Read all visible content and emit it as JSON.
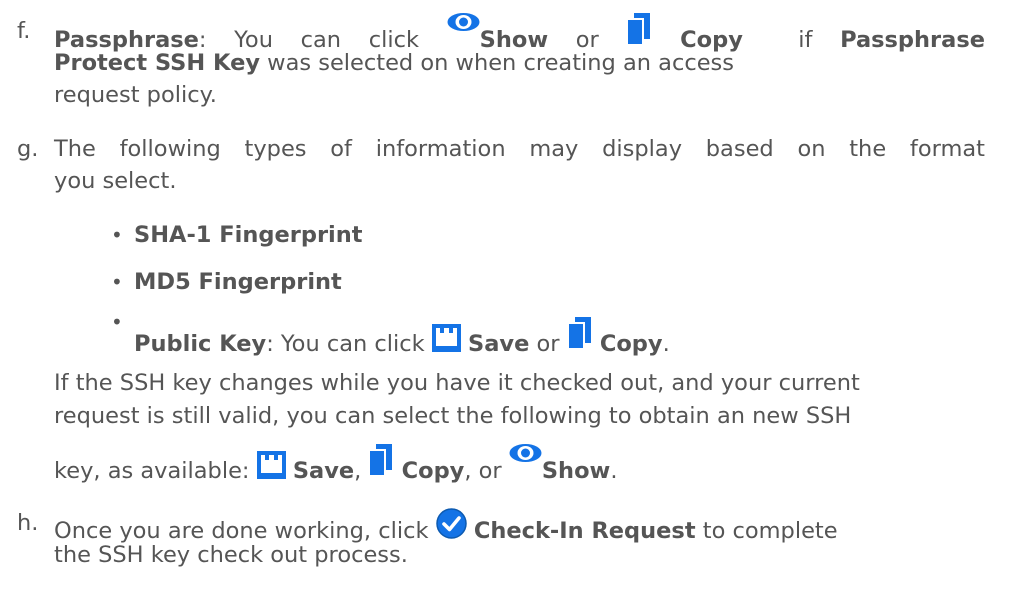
{
  "colors": {
    "text": "#555555",
    "icon": "#1473e6",
    "icon_outline": "#0d5ab0"
  },
  "icons": {
    "show": "eye-icon",
    "copy": "copy-icon",
    "save": "save-icon",
    "check_in": "check-circle-icon"
  },
  "step_f": {
    "marker": "f.",
    "passphrase": "Passphrase",
    "t1": ": You can click ",
    "show": "Show",
    "or": " or ",
    "copy": "Copy",
    "if": "  if ",
    "passphrase_protect_1": "Passphrase",
    "passphrase_protect_2": "Protect SSH Key",
    "t2": " was selected on when creating an access",
    "t3": "request policy."
  },
  "step_g": {
    "marker": "g.",
    "line1": "The following types of information may display based on the format",
    "line2": "you select.",
    "bullets": {
      "b1": "SHA-1 Fingerprint",
      "b2": "MD5 Fingerprint",
      "b3_bold": "Public Key",
      "b3_text": ": You can click ",
      "save": "Save",
      "or": " or ",
      "copy": "Copy",
      "end": "."
    },
    "para1": "If the SSH key changes while you have it checked out, and your current",
    "para2": "request is still valid, you can select the following to obtain an new SSH",
    "para3": "key, as available: ",
    "save": "Save",
    "comma1": ", ",
    "copy": "Copy",
    "comma_or": ", or ",
    "show": "Show",
    "end": "."
  },
  "step_h": {
    "marker": "h.",
    "t1": "Once you are done working, click ",
    "check_in": "Check-In Request",
    "t2": " to complete",
    "t3": "the SSH key check out process."
  }
}
